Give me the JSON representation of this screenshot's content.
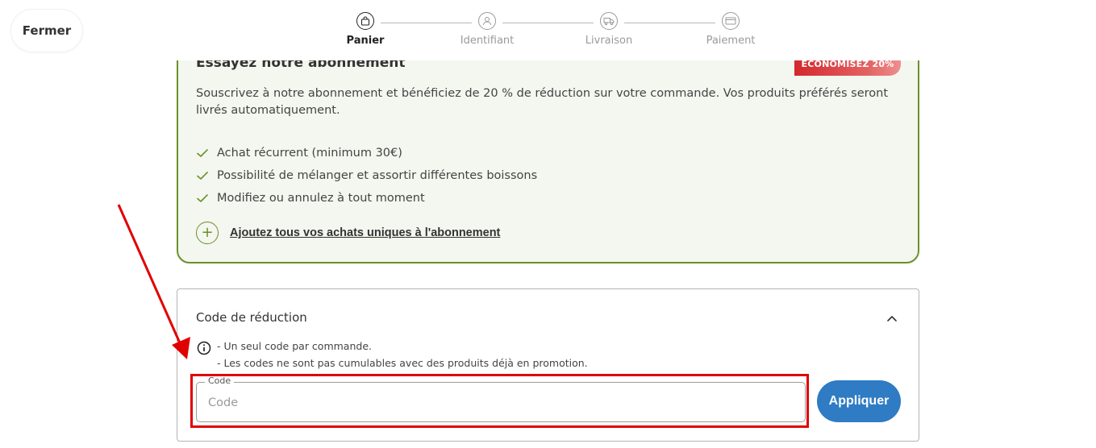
{
  "close_button": {
    "label": "Fermer"
  },
  "stepper": {
    "steps": [
      {
        "label": "Panier",
        "icon": "shopping-bag-icon",
        "active": true
      },
      {
        "label": "Identifiant",
        "icon": "user-icon",
        "active": false
      },
      {
        "label": "Livraison",
        "icon": "truck-icon",
        "active": false
      },
      {
        "label": "Paiement",
        "icon": "card-icon",
        "active": false
      }
    ]
  },
  "subscription": {
    "title": "Essayez notre abonnement",
    "badge": "ÉCONOMISEZ 20%",
    "description": "Souscrivez à notre abonnement et bénéficiez de 20 % de réduction sur votre commande. Vos produits préférés seront livrés automatiquement.",
    "benefits": [
      "Achat récurrent (minimum 30€)",
      "Possibilité de mélanger et assortir différentes boissons",
      "Modifiez ou annulez à tout moment"
    ],
    "add_link": "Ajoutez tous vos achats uniques à l'abonnement"
  },
  "discount": {
    "title": "Code de réduction",
    "info_lines": [
      "- Un seul code par commande.",
      "- Les codes ne sont pas cumulables avec des produits déjà en promotion."
    ],
    "field_label": "Code",
    "field_placeholder": "Code",
    "field_value": "",
    "apply_label": "Appliquer"
  },
  "colors": {
    "accent_green": "#6b8f2a",
    "card_bg": "#f3f7ef",
    "badge_red": "#d4282d",
    "primary_blue": "#2f7bc4",
    "annotation_red": "#e00000"
  }
}
